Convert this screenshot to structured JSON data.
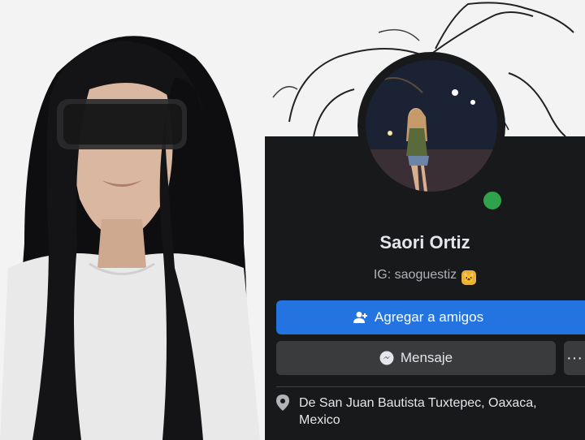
{
  "profile": {
    "name": "Saori Ortiz",
    "instagram": "IG: saoguestiz",
    "instagram_emoji_icon": "cat-face-emoji-icon",
    "online_status_color": "#31a24c"
  },
  "actions": {
    "add_friend_label": "Agregar a amigos",
    "add_friend_icon": "add-person-icon",
    "message_label": "Mensaje",
    "message_icon": "messenger-icon",
    "more_label": "···"
  },
  "details": {
    "location_icon": "location-pin-icon",
    "location_line1": "De San Juan Bautista Tuxtepec, Oaxaca,",
    "location_line2": "Mexico"
  },
  "colors": {
    "primary_button": "#2374e1",
    "secondary_button": "#3a3b3c",
    "background": "#18191a",
    "text_primary": "#e4e6eb",
    "text_secondary": "#b0b3b8"
  }
}
